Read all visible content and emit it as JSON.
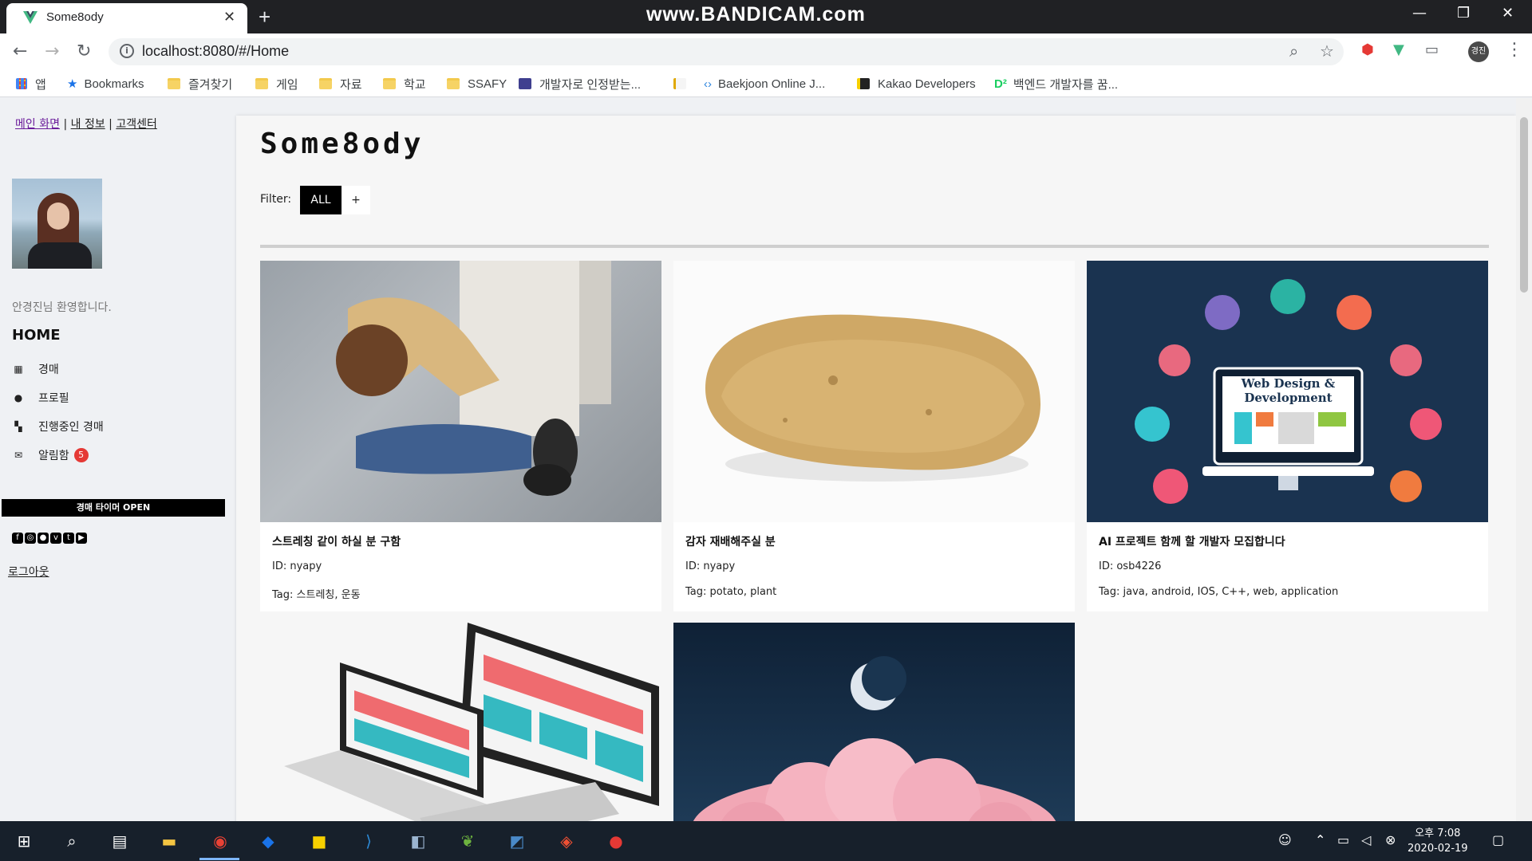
{
  "browser": {
    "tab_title": "Some8ody",
    "watermark": "www.BANDICAM.com",
    "url": "localhost:8080/#/Home",
    "profile_label": "경진",
    "bookmarks": [
      "앱",
      "Bookmarks",
      "즐겨찾기",
      "게임",
      "자료",
      "학교",
      "SSAFY",
      "개발자로 인정받는...",
      "Baekjoon Online J...",
      "Kakao Developers",
      "백엔드 개발자를 꿈..."
    ]
  },
  "topnav": {
    "main": "메인 화면",
    "profile": "내 정보",
    "support": "고객센터",
    "separator": "|"
  },
  "sidebar": {
    "welcome": "안경진님 환영합니다.",
    "home_title": "HOME",
    "menu": [
      {
        "label": "경매",
        "icon": "grid-icon"
      },
      {
        "label": "프로필",
        "icon": "user-icon"
      },
      {
        "label": "진행중인 경매",
        "icon": "tiles-icon"
      },
      {
        "label": "알림함",
        "icon": "envelope-icon",
        "badge": "5"
      }
    ],
    "open_button": "경매 타이머 OPEN",
    "logout": "로그아웃"
  },
  "main": {
    "brand": "Some8ody",
    "filter_label": "Filter:",
    "filter_all": "ALL",
    "filter_add": "+",
    "cards": [
      {
        "title": "스트레칭 같이 하실 분 구함",
        "id": "ID: nyapy",
        "tag": "Tag: 스트레칭, 운동"
      },
      {
        "title": "감자 재배해주실 분",
        "id": "ID: nyapy",
        "tag": "Tag: potato, plant"
      },
      {
        "title": "AI 프로젝트 함께 할 개발자 모집합니다",
        "id": "ID: osb4226",
        "tag": "Tag: java, android, IOS, C++, web, application",
        "image_text": [
          "Web Design &",
          "Development"
        ]
      }
    ]
  },
  "taskbar": {
    "time": "오후 7:08",
    "date": "2020-02-19"
  }
}
